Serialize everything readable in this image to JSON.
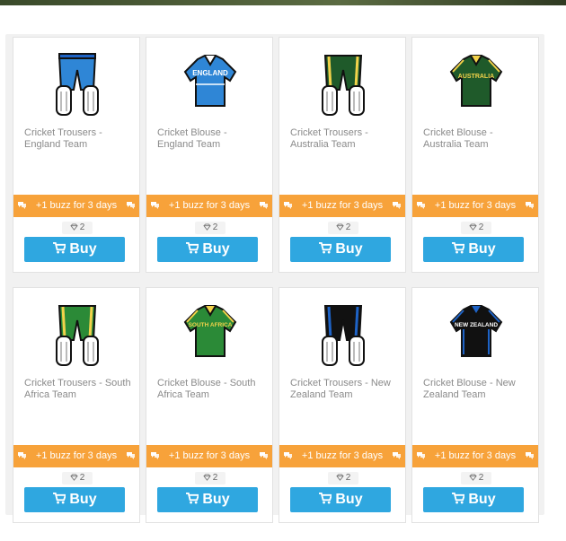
{
  "colors": {
    "promo": "#f7a23a",
    "buy": "#2fa7e0",
    "england_blue": "#2f86d6",
    "australia_green": "#1f5a2a",
    "australia_gold": "#f2d24a",
    "south_africa_green": "#2b8a37",
    "new_zealand_black": "#111111",
    "new_zealand_blue": "#1e63c6",
    "pad_white": "#ffffff"
  },
  "products": [
    {
      "name": "Cricket Trousers - England Team",
      "image_icon": "cricket-trousers-icon",
      "promo": "+1 buzz for 3 days",
      "price": "2",
      "buy_label": "Buy"
    },
    {
      "name": "Cricket Blouse - England Team",
      "image_icon": "cricket-blouse-icon",
      "shirt_text": "ENGLAND",
      "promo": "+1 buzz for 3 days",
      "price": "2",
      "buy_label": "Buy"
    },
    {
      "name": "Cricket Trousers - Australia Team",
      "image_icon": "cricket-trousers-icon",
      "promo": "+1 buzz for 3 days",
      "price": "2",
      "buy_label": "Buy"
    },
    {
      "name": "Cricket Blouse - Australia Team",
      "image_icon": "cricket-blouse-icon",
      "shirt_text": "AUSTRALIA",
      "promo": "+1 buzz for 3 days",
      "price": "2",
      "buy_label": "Buy"
    },
    {
      "name": "Cricket Trousers - South Africa Team",
      "image_icon": "cricket-trousers-icon",
      "promo": "+1 buzz for 3 days",
      "price": "2",
      "buy_label": "Buy"
    },
    {
      "name": "Cricket Blouse - South Africa Team",
      "image_icon": "cricket-blouse-icon",
      "shirt_text": "SOUTH AFRICA",
      "promo": "+1 buzz for 3 days",
      "price": "2",
      "buy_label": "Buy"
    },
    {
      "name": "Cricket Trousers - New Zealand Team",
      "image_icon": "cricket-trousers-icon",
      "promo": "+1 buzz for 3 days",
      "price": "2",
      "buy_label": "Buy"
    },
    {
      "name": "Cricket Blouse - New Zealand Team",
      "image_icon": "cricket-blouse-icon",
      "shirt_text": "NEW ZEALAND",
      "promo": "+1 buzz for 3 days",
      "price": "2",
      "buy_label": "Buy"
    }
  ]
}
